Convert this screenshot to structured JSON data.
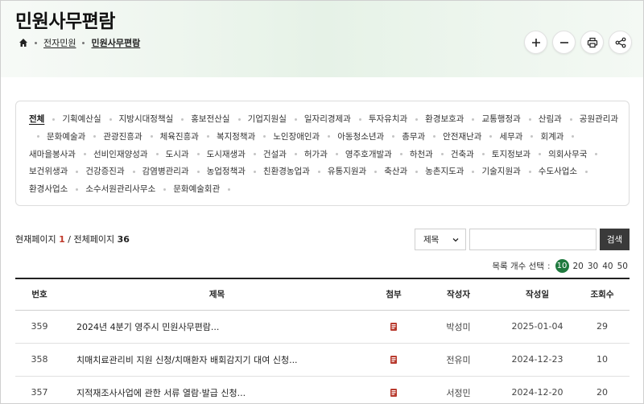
{
  "header": {
    "title": "민원사무편람",
    "breadcrumb": [
      "전자민원",
      "민원사무편람"
    ]
  },
  "tools": {
    "zoom_in": "+",
    "zoom_out": "−"
  },
  "departments": [
    "전체",
    "기획예산실",
    "지방시대정책실",
    "홍보전산실",
    "기업지원실",
    "일자리경제과",
    "투자유치과",
    "환경보호과",
    "교통행정과",
    "산림과",
    "공원관리과",
    "문화예술과",
    "관광진흥과",
    "체육진흥과",
    "복지정책과",
    "노인장애인과",
    "아동청소년과",
    "총무과",
    "안전재난과",
    "세무과",
    "회계과",
    "새마을봉사과",
    "선비인재양성과",
    "도시과",
    "도시재생과",
    "건설과",
    "허가과",
    "영주호개발과",
    "하천과",
    "건축과",
    "토지정보과",
    "의회사무국",
    "보건위생과",
    "건강증진과",
    "감염병관리과",
    "농업정책과",
    "친환경농업과",
    "유통지원과",
    "축산과",
    "농촌지도과",
    "기술지원과",
    "수도사업소",
    "환경사업소",
    "소수서원관리사무소",
    "문화예술회관"
  ],
  "active_department": "전체",
  "page_info": {
    "label_current": "현재페이지",
    "current": "1",
    "slash": "/",
    "label_total": "전체페이지",
    "total": "36"
  },
  "search": {
    "field_option": "제목",
    "query": "",
    "button_label": "검색"
  },
  "per_page": {
    "label": "목록 개수 선택",
    "options": [
      "10",
      "20",
      "30",
      "40",
      "50"
    ],
    "selected": "10"
  },
  "table": {
    "headers": [
      "번호",
      "제목",
      "첨부",
      "작성자",
      "작성일",
      "조회수"
    ],
    "rows": [
      {
        "no": "359",
        "title": "2024년 4분기 영주시 민원사무편람...",
        "author": "박성미",
        "date": "2025-01-04",
        "views": "29"
      },
      {
        "no": "358",
        "title": "치매치료관리비 지원 신청/치매환자 배회감지기 대여 신청...",
        "author": "전유미",
        "date": "2024-12-23",
        "views": "10"
      },
      {
        "no": "357",
        "title": "지적재조사사업에 관한 서류 열람·발급 신청...",
        "author": "서정민",
        "date": "2024-12-20",
        "views": "20"
      }
    ]
  },
  "colors": {
    "accent_green": "#1f7a3e",
    "current_page_red": "#c0392b",
    "search_button": "#3a3a3a"
  }
}
